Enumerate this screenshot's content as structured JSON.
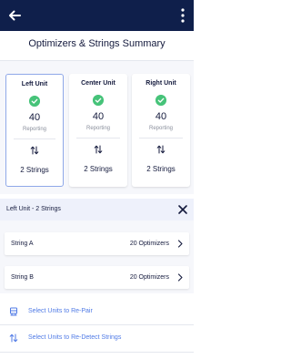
{
  "header": {
    "back_icon": "arrow-left-icon",
    "menu_icon": "more-vertical-icon",
    "title": "Optimizers & Strings Summary"
  },
  "units": [
    {
      "name": "Left Unit",
      "status_icon": "check-circle-icon",
      "count": "40",
      "count_label": "Reporting",
      "strings_icon": "swap-vertical-icon",
      "strings": "2 Strings",
      "selected": true
    },
    {
      "name": "Center Unit",
      "status_icon": "check-circle-icon",
      "count": "40",
      "count_label": "Reporting",
      "strings_icon": "swap-vertical-icon",
      "strings": "2 Strings",
      "selected": false
    },
    {
      "name": "Right Unit",
      "status_icon": "check-circle-icon",
      "count": "40",
      "count_label": "Reporting",
      "strings_icon": "swap-vertical-icon",
      "strings": "2 Strings",
      "selected": false
    }
  ],
  "detail": {
    "title": "Left Unit - 2 Strings",
    "close_icon": "close-icon",
    "strings": [
      {
        "name": "String A",
        "optimizers": "20 Optimizers"
      },
      {
        "name": "String B",
        "optimizers": "20 Optimizers"
      }
    ]
  },
  "actions": [
    {
      "label": "Select Units to Re-Pair",
      "icon": "pair-device-icon"
    },
    {
      "label": "Select Units to Re-Detect Strings",
      "icon": "swap-vertical-icon"
    }
  ],
  "colors": {
    "topbar": "#0f1f4b",
    "accent": "#4f7ae6",
    "success": "#46c379",
    "selected_border": "#8fa8e8"
  }
}
